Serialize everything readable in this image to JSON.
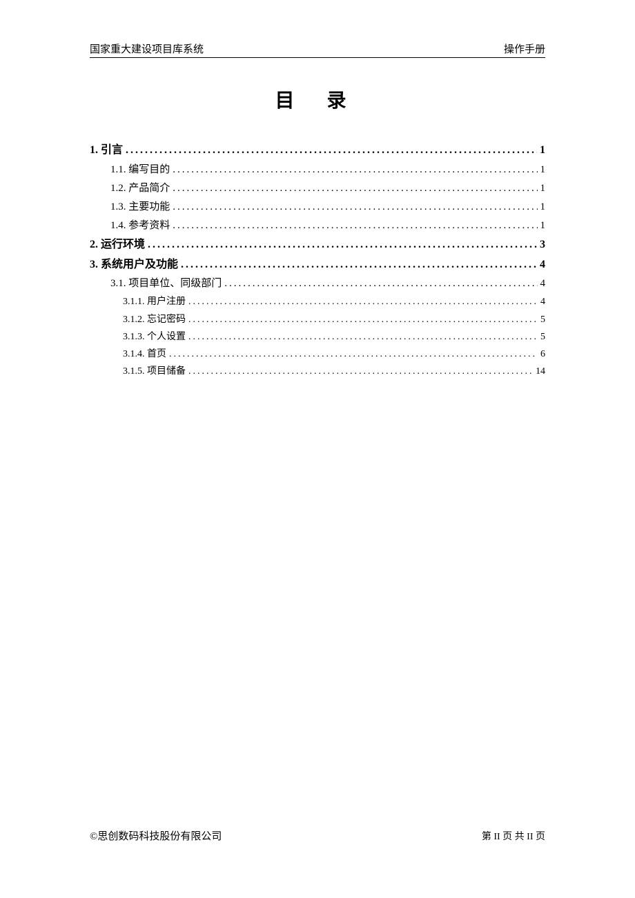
{
  "header": {
    "left": "国家重大建设项目库系统",
    "right": "操作手册"
  },
  "title": "目 录",
  "toc": [
    {
      "level": 1,
      "number": "1.",
      "label": "引言",
      "page": "1"
    },
    {
      "level": 2,
      "number": "1.1.",
      "label": "编写目的",
      "page": "1"
    },
    {
      "level": 2,
      "number": "1.2.",
      "label": "产品简介",
      "page": "1"
    },
    {
      "level": 2,
      "number": "1.3.",
      "label": "主要功能",
      "page": "1"
    },
    {
      "level": 2,
      "number": "1.4.",
      "label": "参考资料",
      "page": "1"
    },
    {
      "level": 1,
      "number": "2.",
      "label": "运行环境",
      "page": "3"
    },
    {
      "level": 1,
      "number": "3.",
      "label": "系统用户及功能",
      "page": "4"
    },
    {
      "level": 2,
      "number": "3.1.",
      "label": "项目单位、同级部门",
      "page": "4"
    },
    {
      "level": 3,
      "number": "3.1.1.",
      "label": "用户注册",
      "page": "4"
    },
    {
      "level": 3,
      "number": "3.1.2.",
      "label": "忘记密码",
      "page": "5"
    },
    {
      "level": 3,
      "number": "3.1.3.",
      "label": "个人设置",
      "page": "5"
    },
    {
      "level": 3,
      "number": "3.1.4.",
      "label": "首页",
      "page": "6"
    },
    {
      "level": 3,
      "number": "3.1.5.",
      "label": "项目储备",
      "page": "14"
    }
  ],
  "footer": {
    "left": "©思创数码科技股份有限公司",
    "right": "第 II 页 共 II 页"
  }
}
